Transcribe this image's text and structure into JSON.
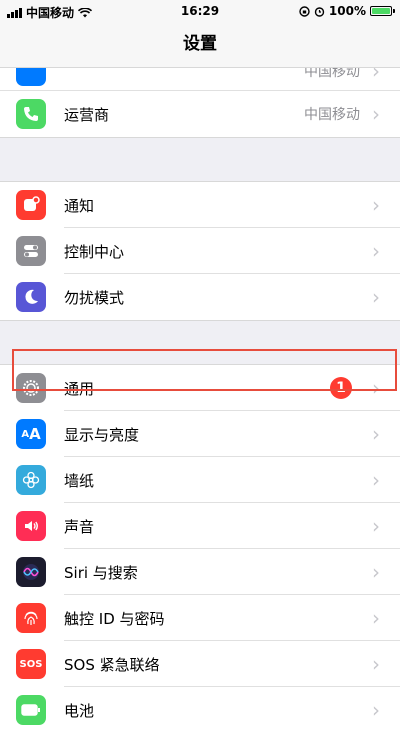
{
  "status_bar": {
    "carrier": "中国移动",
    "time": "16:29",
    "battery_percent": "100%",
    "battery_level": 1.0
  },
  "nav": {
    "title": "设置"
  },
  "partial_row": {
    "detail": "中国移动"
  },
  "rows": {
    "carrier": {
      "label": "运营商",
      "detail": "中国移动",
      "icon": "phone-icon",
      "color": "#4cd964"
    },
    "notifications": {
      "label": "通知",
      "icon": "notification-icon",
      "color": "#ff3b30"
    },
    "control_center": {
      "label": "控制中心",
      "icon": "toggle-icon",
      "color": "#8e8e93"
    },
    "dnd": {
      "label": "勿扰模式",
      "icon": "moon-icon",
      "color": "#5856d6"
    },
    "general": {
      "label": "通用",
      "icon": "gear-icon",
      "color": "#8e8e93",
      "badge": "1"
    },
    "display": {
      "label": "显示与亮度",
      "icon": "text-size-icon",
      "color": "#007aff"
    },
    "wallpaper": {
      "label": "墙纸",
      "icon": "flower-icon",
      "color": "#34aadc"
    },
    "sounds": {
      "label": "声音",
      "icon": "speaker-icon",
      "color": "#ff2d55"
    },
    "siri": {
      "label": "Siri 与搜索",
      "icon": "siri-icon",
      "color": "#1c1c2e"
    },
    "touchid": {
      "label": "触控 ID 与密码",
      "icon": "fingerprint-icon",
      "color": "#ff3b30"
    },
    "sos": {
      "label": "SOS 紧急联络",
      "icon": "sos-icon",
      "color": "#ff3b30",
      "icon_text": "SOS"
    },
    "battery": {
      "label": "电池",
      "icon": "battery-icon",
      "color": "#4cd964"
    }
  },
  "chevron": "›"
}
